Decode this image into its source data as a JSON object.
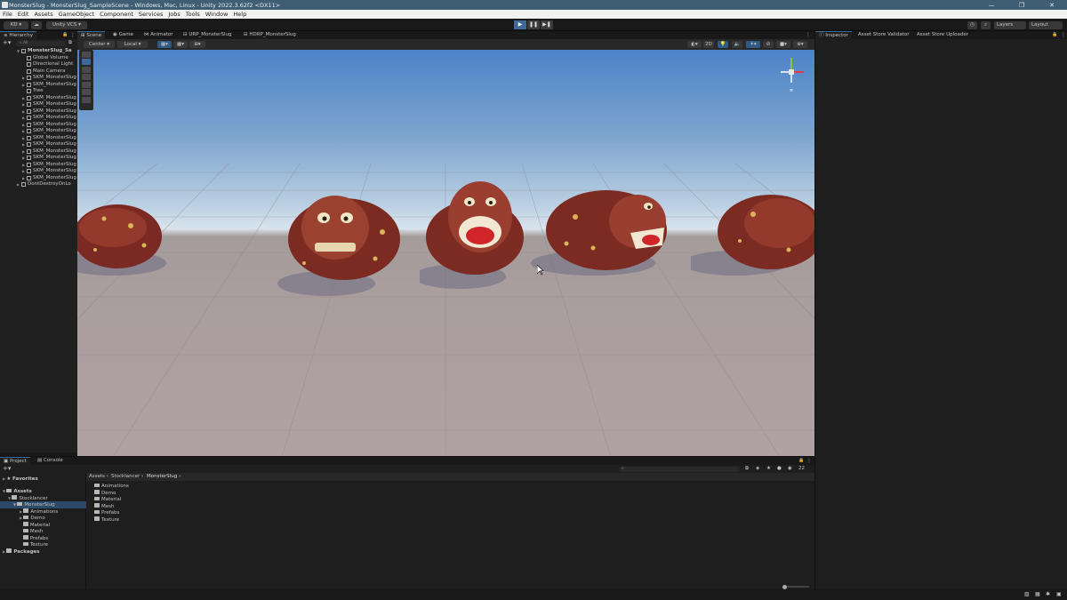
{
  "window": {
    "title": "MonsterSlug - MonsterSlug_SampleScene - Windows, Mac, Linux - Unity 2022.3.62f2 <DX11>",
    "controls": [
      "—",
      "❐",
      "✕"
    ]
  },
  "menu": [
    "File",
    "Edit",
    "Assets",
    "GameObject",
    "Component",
    "Services",
    "Jobs",
    "Tools",
    "Window",
    "Help"
  ],
  "toolbar": {
    "account": "KD ▾",
    "cloud": "☁",
    "vcs": "Unity VCS ▾",
    "play": "▶",
    "pause": "❚❚",
    "step": "▶❚",
    "history": "◷",
    "search": "⌕",
    "layers": "Layers",
    "layout": "Layout"
  },
  "hierarchy": {
    "tab": "Hierarchy",
    "search_placeholder": "All",
    "root": "MonsterSlug_Sa",
    "items": [
      {
        "label": "Global Volume",
        "arrow": false
      },
      {
        "label": "Directional Light",
        "arrow": false
      },
      {
        "label": "Main Camera",
        "arrow": false
      },
      {
        "label": "SKM_MonsterSlug",
        "arrow": true
      },
      {
        "label": "SKM_MonsterSlug",
        "arrow": true
      },
      {
        "label": "Tree",
        "arrow": false
      },
      {
        "label": "SKM_MonsterSlug",
        "arrow": true
      },
      {
        "label": "SKM_MonsterSlug",
        "arrow": true
      },
      {
        "label": "SKM_MonsterSlug",
        "arrow": true
      },
      {
        "label": "SKM_MonsterSlug",
        "arrow": true
      },
      {
        "label": "SKM_MonsterSlug",
        "arrow": true
      },
      {
        "label": "SKM_MonsterSlug",
        "arrow": true
      },
      {
        "label": "SKM_MonsterSlug",
        "arrow": true
      },
      {
        "label": "SKM_MonsterSlug",
        "arrow": true
      },
      {
        "label": "SKM_MonsterSlug",
        "arrow": true
      },
      {
        "label": "SKM_MonsterSlug",
        "arrow": true
      },
      {
        "label": "SKM_MonsterSlug",
        "arrow": true
      },
      {
        "label": "SKM_MonsterSlug",
        "arrow": true
      },
      {
        "label": "SKM_MonsterSlug",
        "arrow": true
      }
    ],
    "dontdestroy": "DontDestroyOnLo"
  },
  "center_tabs": [
    "Scene",
    "Game",
    "Animator",
    "URP_MonsterSlug",
    "HDRP_MonsterSlug"
  ],
  "scene_toolbar": {
    "pivot": "Center ▾",
    "space": "Local ▾",
    "mode2d": "2D"
  },
  "right_tabs": [
    "Inspector",
    "Asset Store Validator",
    "Asset Store Uploader"
  ],
  "bottom_tabs": [
    "Project",
    "Console"
  ],
  "project": {
    "favorites": "Favorites",
    "assets": "Assets",
    "stocklancer": "Stocklancer",
    "monsterslug": "MonsterSlug",
    "subfolders": [
      "Animations",
      "Demo",
      "Material",
      "Mesh",
      "Prefabs",
      "Texture"
    ],
    "packages": "Packages",
    "breadcrumb": [
      "Assets",
      "Stocklancer",
      "MonsterSlug"
    ],
    "contents": [
      "Animations",
      "Demo",
      "Material",
      "Mesh",
      "Prefabs",
      "Texture"
    ],
    "count": "22"
  },
  "colors": {
    "titlebar": "#3f5d73",
    "panel": "#202020",
    "selection": "#2c5d87",
    "play_active": "#3d6a99"
  }
}
